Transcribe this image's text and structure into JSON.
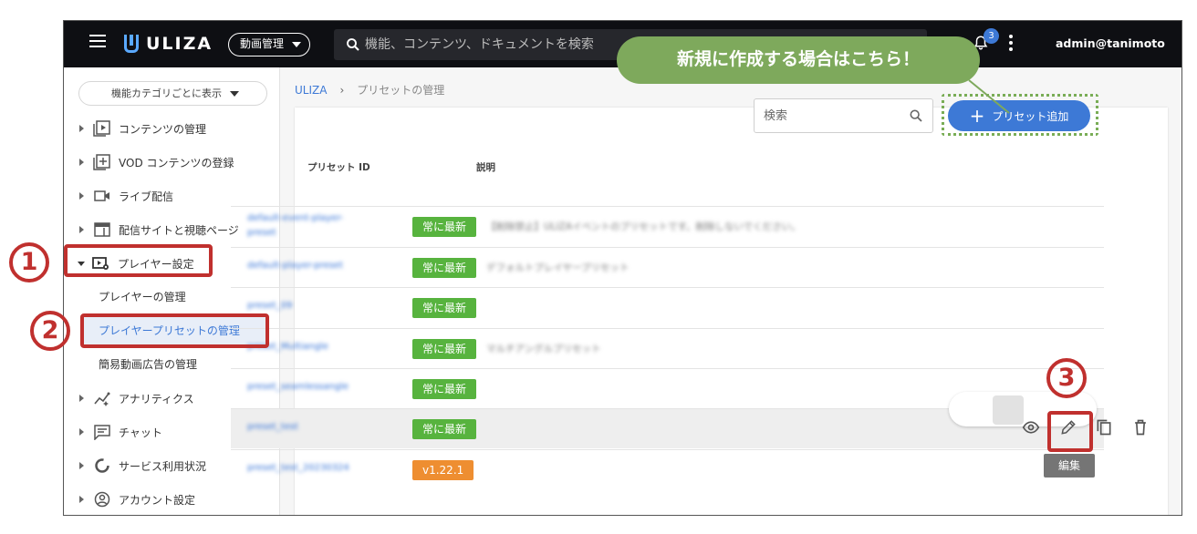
{
  "topbar": {
    "logo_text": "ULIZA",
    "product": "動画管理",
    "search_placeholder": "機能、コンテンツ、ドキュメントを検索",
    "notification_count": "3",
    "user": "admin@tanimoto"
  },
  "sidebar": {
    "category_select": "機能カテゴリごとに表示",
    "items": [
      {
        "label": "コンテンツの管理",
        "icon": "play-square-icon"
      },
      {
        "label": "VOD コンテンツの登録",
        "icon": "add-square-icon"
      },
      {
        "label": "ライブ配信",
        "icon": "video-camera-icon"
      },
      {
        "label": "配信サイトと視聴ページ",
        "icon": "web-page-icon"
      },
      {
        "label": "プレイヤー設定",
        "icon": "player-settings-icon",
        "expanded": true
      },
      {
        "label": "アナリティクス",
        "icon": "analytics-icon"
      },
      {
        "label": "チャット",
        "icon": "chat-icon"
      },
      {
        "label": "サービス利用状況",
        "icon": "usage-ring-icon"
      },
      {
        "label": "アカウント設定",
        "icon": "account-icon"
      }
    ],
    "sub_items": [
      {
        "label": "プレイヤーの管理"
      },
      {
        "label": "プレイヤープリセットの管理",
        "active": true
      },
      {
        "label": "簡易動画広告の管理"
      }
    ]
  },
  "breadcrumb": {
    "home": "ULIZA",
    "current": "プリセットの管理"
  },
  "toolbar": {
    "search_placeholder": "検索",
    "add_button": "プリセット追加"
  },
  "table": {
    "columns": [
      "プリセット ID",
      "説明"
    ],
    "rows": [
      {
        "id": "default-event-player-preset",
        "status": "常に最新",
        "status_color": "#57b33e",
        "description": "【削除禁止】ULIZAイベントのプリセットです。削除しないでください。"
      },
      {
        "id": "default-player-preset",
        "status": "常に最新",
        "status_color": "#57b33e",
        "description": "デフォルトプレイヤープリセット"
      },
      {
        "id": "preset_09",
        "status": "常に最新",
        "status_color": "#57b33e",
        "description": ""
      },
      {
        "id": "preset_Multiangle",
        "status": "常に最新",
        "status_color": "#57b33e",
        "description": "マルチアングルプリセット"
      },
      {
        "id": "preset_seamlessangle",
        "status": "常に最新",
        "status_color": "#57b33e",
        "description": ""
      },
      {
        "id": "preset_test",
        "status": "常に最新",
        "status_color": "#57b33e",
        "description": ""
      },
      {
        "id": "preset_test_20230324",
        "status": "v1.22.1",
        "status_color": "#ee8e31",
        "description": ""
      }
    ]
  },
  "row_actions": {
    "icons": [
      "eye-icon",
      "pencil-icon",
      "copy-icon",
      "trash-icon"
    ],
    "tooltip": "編集"
  },
  "annotations": {
    "callout": "新規に作成する場合はこちら！",
    "step1": "1",
    "step2": "2",
    "step3": "3"
  },
  "colors": {
    "accent": "#3d79d6",
    "annotation_red": "#c0302e",
    "callout_green": "#7ea95c",
    "topbar": "#0e0f13"
  }
}
